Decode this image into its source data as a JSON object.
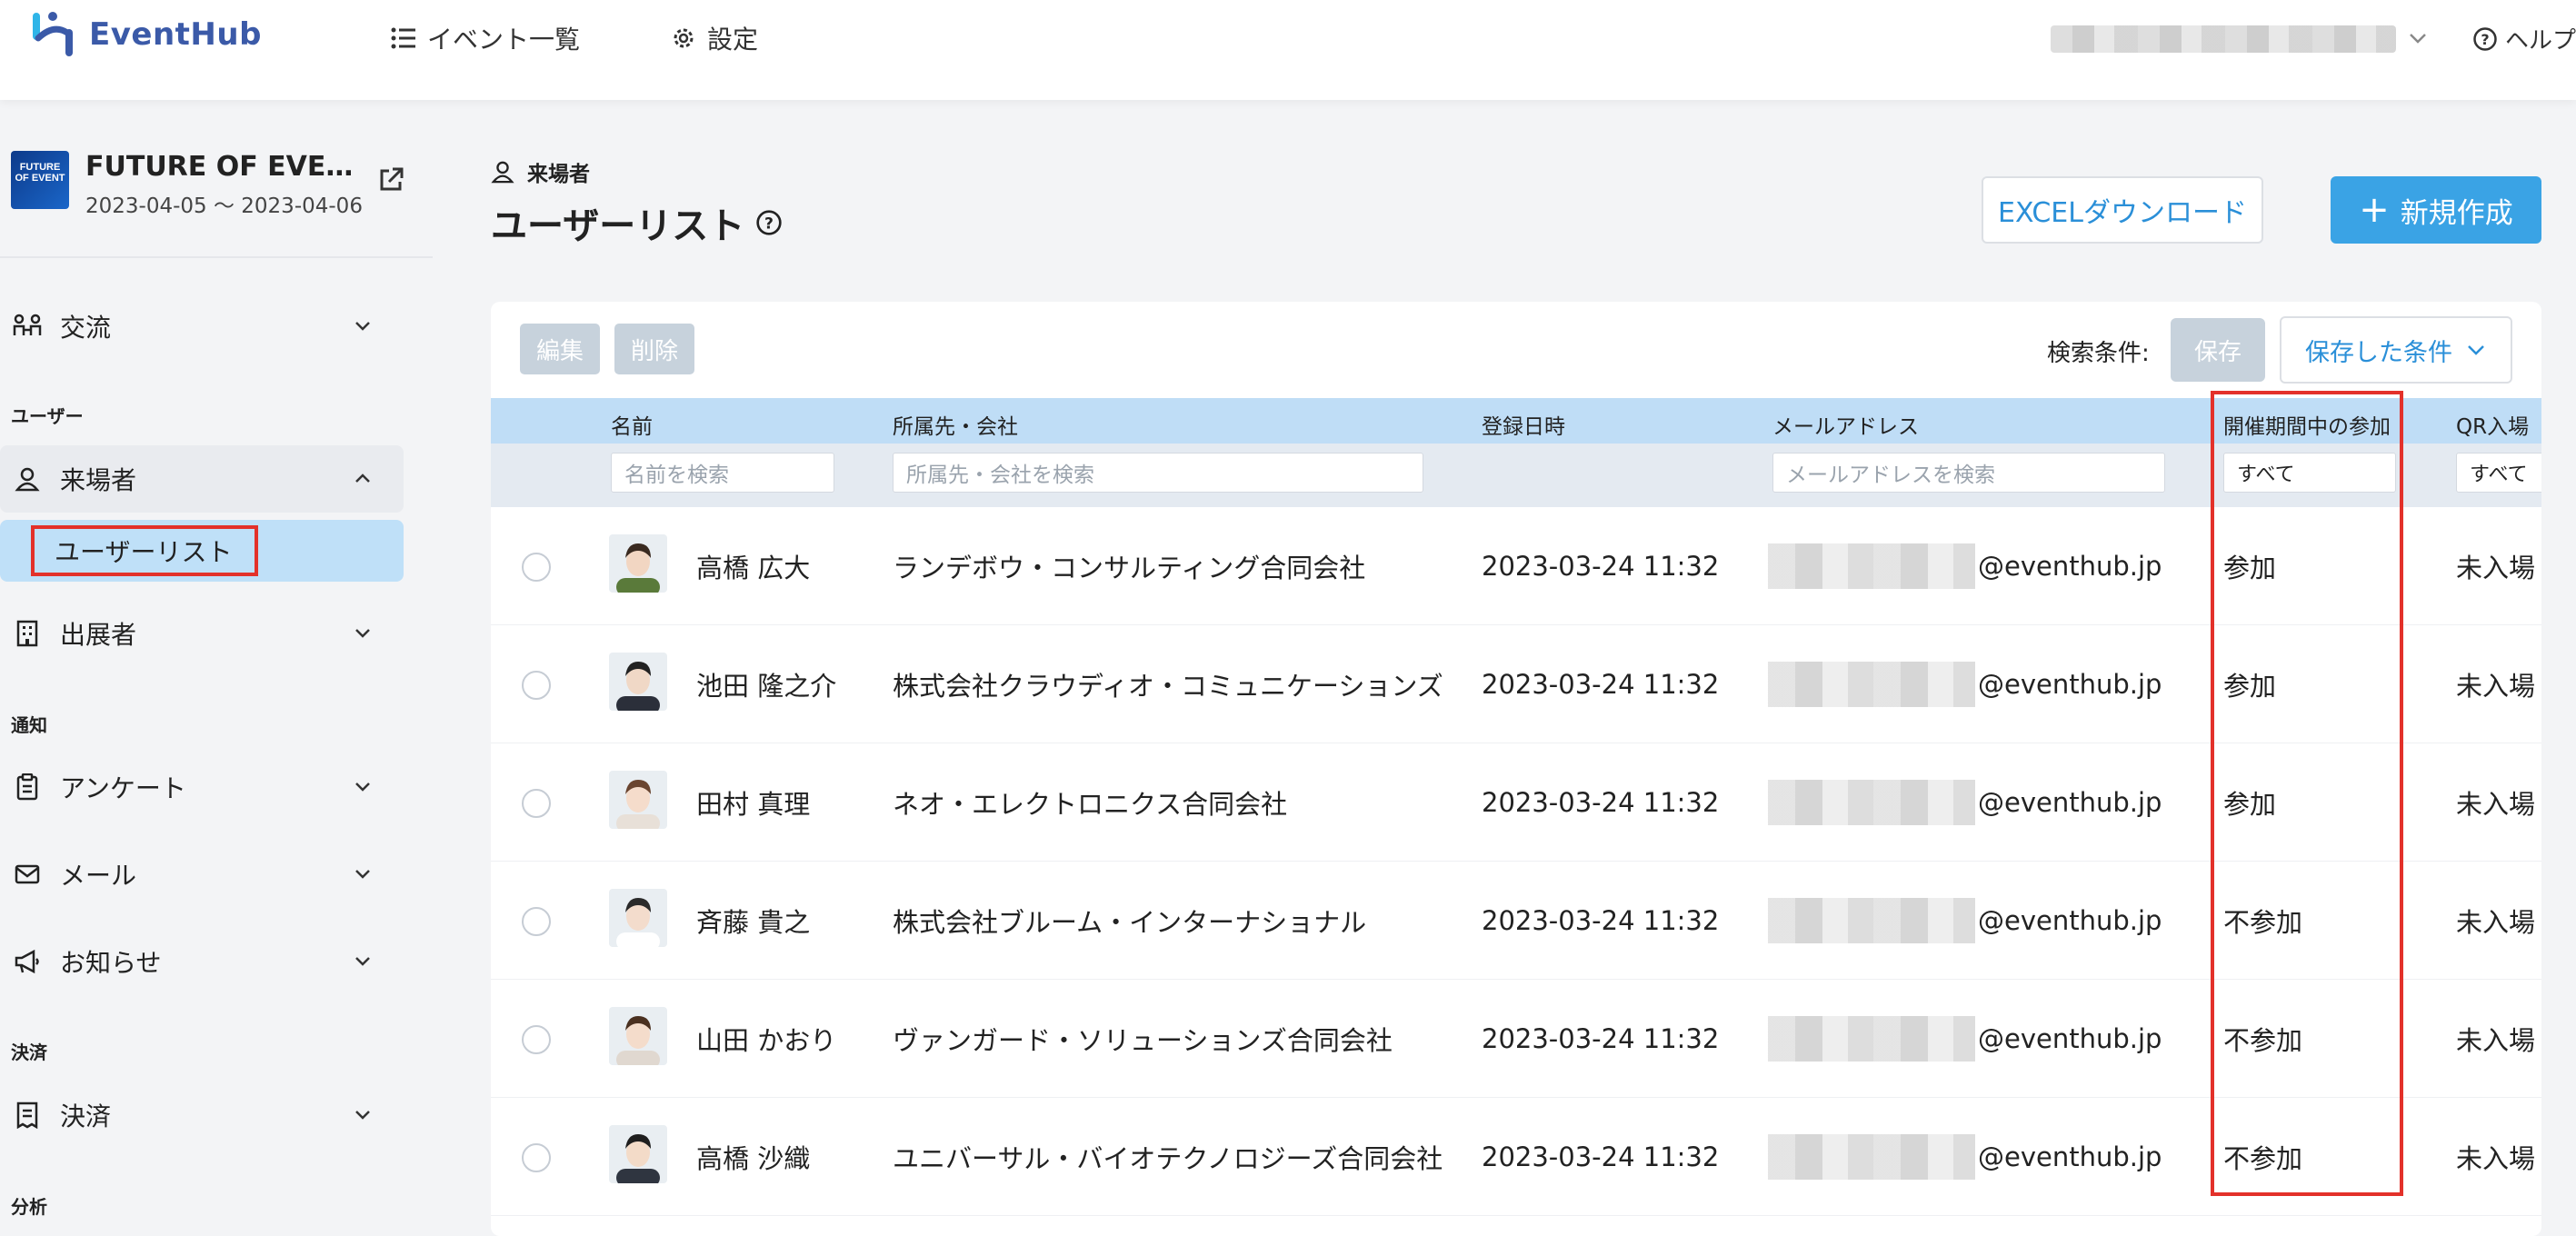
{
  "app": {
    "name": "EventHub",
    "brand_color": "#3b5aa8",
    "accent": "#3aa3e5",
    "highlight_color": "#e3312a"
  },
  "topnav": {
    "events_label": "イベント一覧",
    "settings_label": "設定",
    "help_label": "ヘルプ"
  },
  "event": {
    "title": "FUTURE OF EVEN…",
    "dates": "2023-04-05 〜 2023-04-06",
    "thumb_text": "FUTURE OF EVENT"
  },
  "sidebar": {
    "koryu": "交流",
    "section_user": "ユーザー",
    "visitors": "来場者",
    "user_list": "ユーザーリスト",
    "exhibitors": "出展者",
    "section_notice": "通知",
    "survey": "アンケート",
    "mail": "メール",
    "news": "お知らせ",
    "section_payment": "決済",
    "payment": "決済",
    "section_analytics": "分析"
  },
  "main": {
    "breadcrumb": "来場者",
    "title": "ユーザーリスト",
    "excel_button": "EXCELダウンロード",
    "new_button": "新規作成"
  },
  "toolbar": {
    "edit": "編集",
    "delete": "削除",
    "search_cond_label": "検索条件:",
    "save": "保存",
    "saved_conditions": "保存した条件"
  },
  "table": {
    "columns": {
      "name": "名前",
      "company": "所属先・会社",
      "registered": "登録日時",
      "email": "メールアドレス",
      "participation": "開催期間中の参加",
      "qr": "QR入場"
    },
    "filters": {
      "name_placeholder": "名前を検索",
      "company_placeholder": "所属先・会社を検索",
      "email_placeholder": "メールアドレスを検索",
      "participation_value": "すべて",
      "qr_value": "すべて"
    },
    "rows": [
      {
        "name": "高橋 広大",
        "company": "ランデボウ・コンサルティング合同会社",
        "registered": "2023-03-24 11:32",
        "email_domain": "@eventhub.jp",
        "participation": "参加",
        "qr": "未入場"
      },
      {
        "name": "池田 隆之介",
        "company": "株式会社クラウディオ・コミュニケーションズ",
        "registered": "2023-03-24 11:32",
        "email_domain": "@eventhub.jp",
        "participation": "参加",
        "qr": "未入場"
      },
      {
        "name": "田村 真理",
        "company": "ネオ・エレクトロニクス合同会社",
        "registered": "2023-03-24 11:32",
        "email_domain": "@eventhub.jp",
        "participation": "参加",
        "qr": "未入場"
      },
      {
        "name": "斉藤 貴之",
        "company": "株式会社ブルーム・インターナショナル",
        "registered": "2023-03-24 11:32",
        "email_domain": "@eventhub.jp",
        "participation": "不参加",
        "qr": "未入場"
      },
      {
        "name": "山田 かおり",
        "company": "ヴァンガード・ソリューションズ合同会社",
        "registered": "2023-03-24 11:32",
        "email_domain": "@eventhub.jp",
        "participation": "不参加",
        "qr": "未入場"
      },
      {
        "name": "高橋 沙織",
        "company": "ユニバーサル・バイオテクノロジーズ合同会社",
        "registered": "2023-03-24 11:32",
        "email_domain": "@eventhub.jp",
        "participation": "不参加",
        "qr": "未入場"
      }
    ]
  }
}
